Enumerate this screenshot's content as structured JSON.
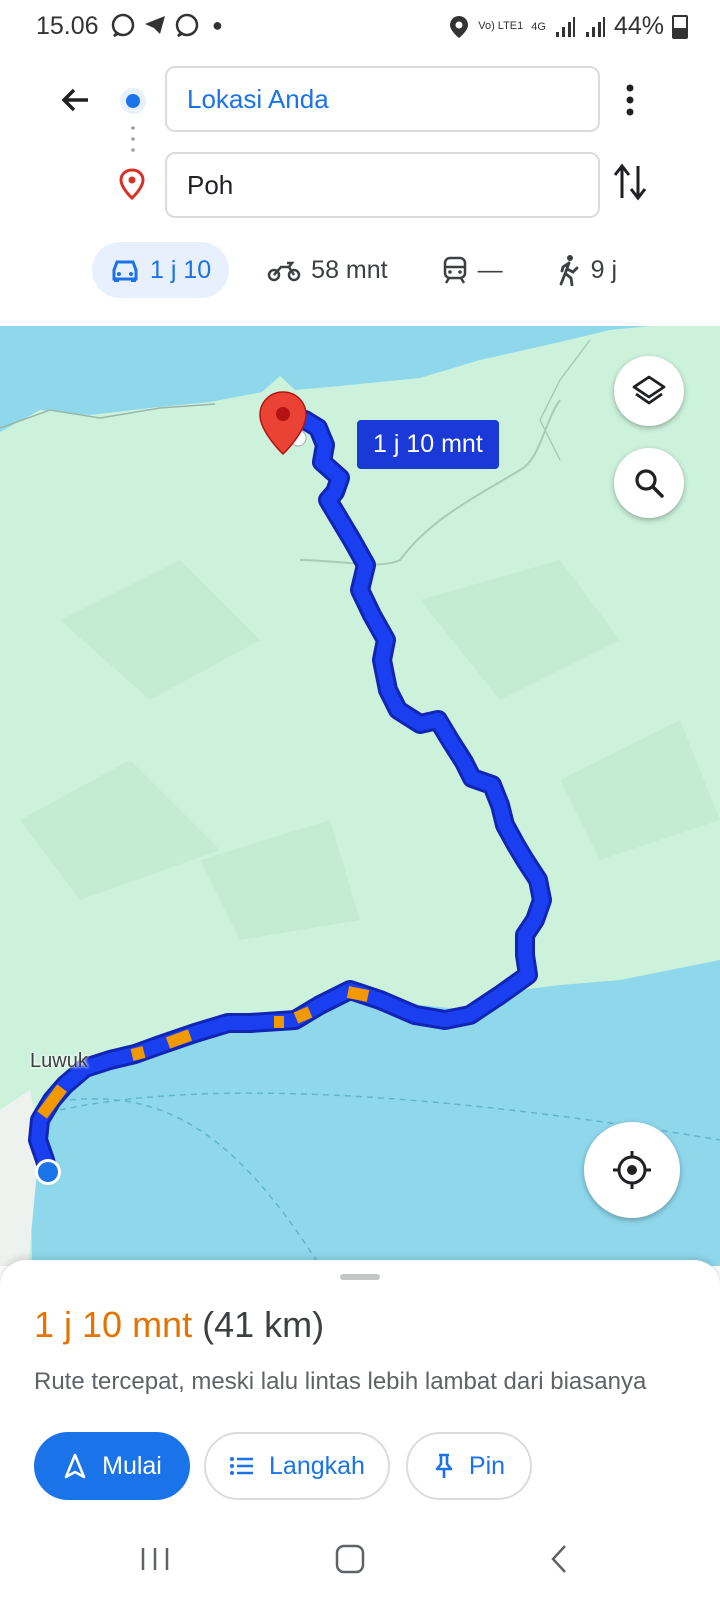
{
  "status_bar": {
    "time": "15.06",
    "battery": "44%",
    "network": "4G",
    "volte": "Vo) LTE1"
  },
  "directions": {
    "origin": "Lokasi Anda",
    "destination": "Poh"
  },
  "modes": [
    {
      "name": "car",
      "label": "1 j 10",
      "active": true
    },
    {
      "name": "motorcycle",
      "label": "58 mnt"
    },
    {
      "name": "transit",
      "label": "—"
    },
    {
      "name": "walk",
      "label": "9 j"
    }
  ],
  "map": {
    "eta_label": "1 j 10 mnt",
    "place_label": "Luwuk",
    "icons": [
      "layers-icon",
      "search-icon",
      "my-location-icon",
      "destination-pin-icon",
      "origin-dot-icon"
    ]
  },
  "route_summary": {
    "duration": "1 j 10 mnt",
    "distance": "(41 km)",
    "description": "Rute tercepat, meski lalu lintas lebih lambat dari biasanya"
  },
  "actions": {
    "start_label": "Mulai",
    "steps_label": "Langkah",
    "pin_label": "Pin"
  },
  "colors": {
    "accent": "#1a73e8",
    "route": "#1a3ff0",
    "traffic_slow": "#f29900",
    "duration_text": "#e37400",
    "land": "#cdf2dc",
    "water": "#8fd8ec"
  }
}
